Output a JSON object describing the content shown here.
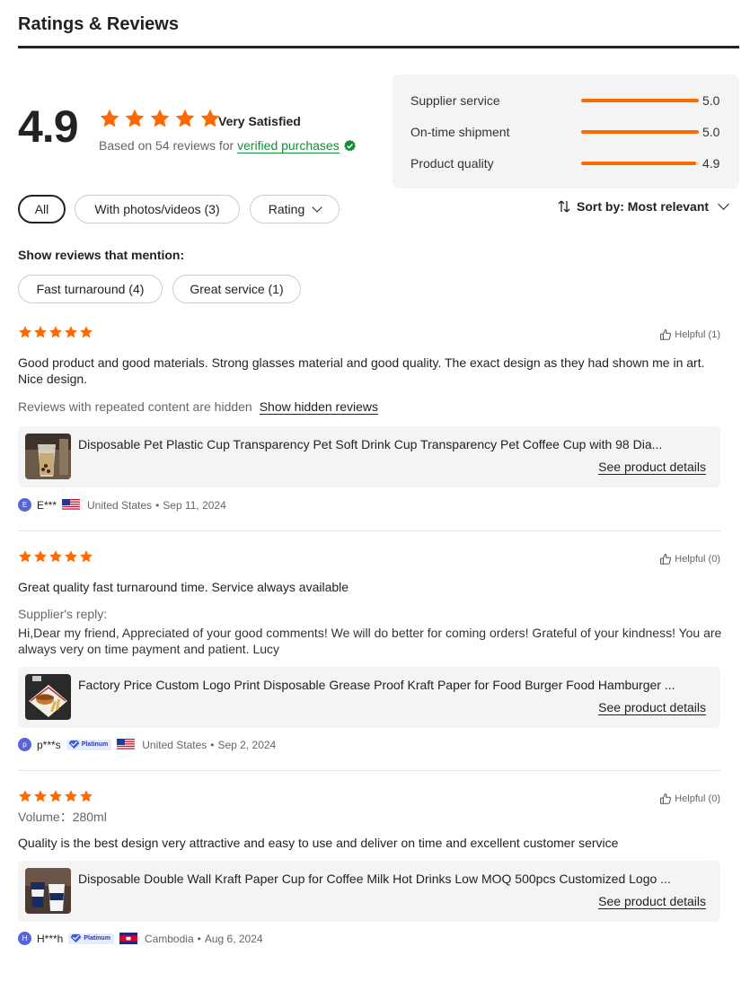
{
  "header": {
    "title": "Ratings & Reviews"
  },
  "summary": {
    "score": "4.9",
    "satisfaction": "Very Satisfied",
    "based_on": "Based on 54 reviews for",
    "verified_link": "verified purchases"
  },
  "metrics": [
    {
      "label": "Supplier service",
      "value": "5.0",
      "level": 1.0
    },
    {
      "label": "On-time shipment",
      "value": "5.0",
      "level": 1.0
    },
    {
      "label": "Product quality",
      "value": "4.9",
      "level": 0.98
    }
  ],
  "filters": {
    "all": "All",
    "photos": "With photos/videos (3)",
    "rating": "Rating"
  },
  "sort": {
    "label": "Sort by: Most relevant"
  },
  "mentions": {
    "title": "Show reviews that mention:",
    "tags": [
      "Fast turnaround (4)",
      "Great service (1)"
    ]
  },
  "colors": {
    "accent": "#ff6a00",
    "verified": "#1a8a3a",
    "avatar": "#5865d6"
  },
  "reviews": [
    {
      "stars": 5,
      "helpful": "Helpful (1)",
      "text": "Good product and good materials. Strong glasses material and good quality. The exact design as they had shown me in art. Nice design.",
      "hidden_note": "Reviews with repeated content are hidden",
      "show_hidden": "Show hidden reviews",
      "product": "Disposable Pet Plastic Cup Transparency Pet Soft Drink Cup Transparency Pet Coffee Cup with 98 Dia...",
      "see_details": "See product details",
      "avatar_letter": "E",
      "reviewer": "E***",
      "country": "United States",
      "date": "Sep 11, 2024",
      "flag": "us-flag-icon"
    },
    {
      "stars": 5,
      "helpful": "Helpful (0)",
      "text": "Great quality fast turnaround time. Service always available",
      "reply_label": "Supplier's reply:",
      "reply": "Hi,Dear my friend, Appreciated of your good comments! We will do better for coming orders! Grateful of your kindness! You are always very on time payment and patient. Lucy",
      "product": "Factory Price Custom Logo Print Disposable Grease Proof Kraft Paper for Food Burger Food Hamburger ...",
      "see_details": "See product details",
      "avatar_letter": "p",
      "reviewer": "p***s",
      "badge": "Platinum",
      "country": "United States",
      "date": "Sep 2, 2024",
      "flag": "us-flag-icon"
    },
    {
      "stars": 5,
      "helpful": "Helpful (0)",
      "volume": "Volume：280ml",
      "text": "Quality is the best design very attractive and easy to use and deliver on time and excellent customer service",
      "product": "Disposable Double Wall Kraft Paper Cup for Coffee Milk Hot Drinks Low MOQ 500pcs Customized Logo ...",
      "see_details": "See product details",
      "avatar_letter": "H",
      "reviewer": "H***h",
      "badge": "Platinum",
      "country": "Cambodia",
      "date": "Aug 6, 2024",
      "flag": "cambodia-flag-icon"
    }
  ]
}
